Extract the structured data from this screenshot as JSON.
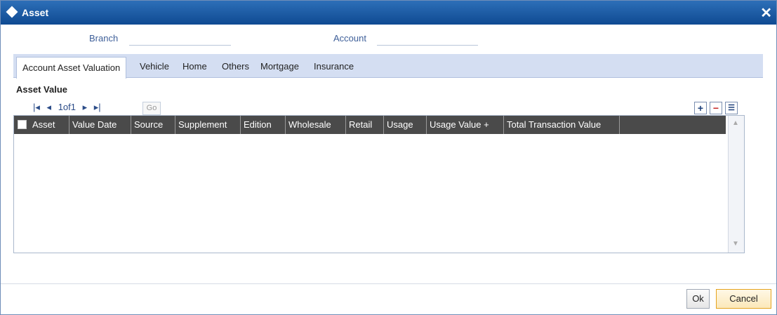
{
  "window": {
    "title": "Asset"
  },
  "fields": {
    "branch_label": "Branch",
    "account_label": "Account"
  },
  "tabs": [
    {
      "label": "Account Asset Valuation"
    },
    {
      "label": "Vehicle"
    },
    {
      "label": "Home"
    },
    {
      "label": "Others"
    },
    {
      "label": "Mortgage"
    },
    {
      "label": "Insurance"
    }
  ],
  "section": {
    "title": "Asset Value"
  },
  "pager": {
    "text": "1of1",
    "go_label": "Go"
  },
  "grid": {
    "columns": [
      "Asset",
      "Value Date",
      "Source",
      "Supplement",
      "Edition",
      "Wholesale",
      "Retail",
      "Usage",
      "Usage Value +",
      "Total Transaction Value"
    ]
  },
  "buttons": {
    "ok": "Ok",
    "cancel": "Cancel"
  },
  "icons": {
    "title": "diamond-icon",
    "close": "close-icon"
  }
}
